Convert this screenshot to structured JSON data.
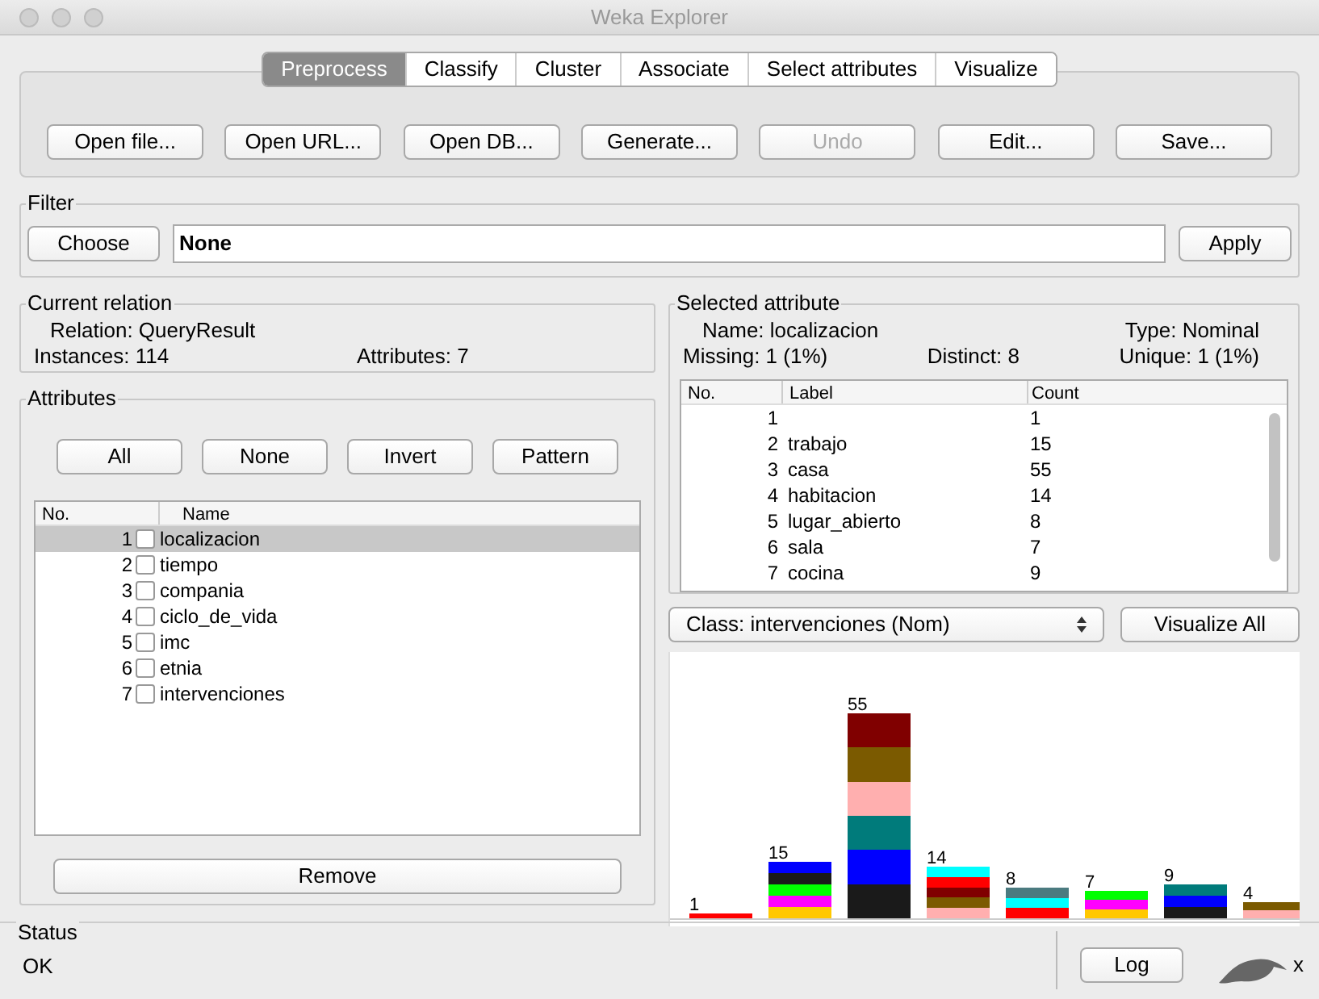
{
  "window": {
    "title": "Weka Explorer"
  },
  "tabs": [
    {
      "label": "Preprocess",
      "selected": true
    },
    {
      "label": "Classify",
      "selected": false
    },
    {
      "label": "Cluster",
      "selected": false
    },
    {
      "label": "Associate",
      "selected": false
    },
    {
      "label": "Select attributes",
      "selected": false
    },
    {
      "label": "Visualize",
      "selected": false
    }
  ],
  "toolbar": [
    {
      "label": "Open file...",
      "disabled": false
    },
    {
      "label": "Open URL...",
      "disabled": false
    },
    {
      "label": "Open DB...",
      "disabled": false
    },
    {
      "label": "Generate...",
      "disabled": false
    },
    {
      "label": "Undo",
      "disabled": true
    },
    {
      "label": "Edit...",
      "disabled": false
    },
    {
      "label": "Save...",
      "disabled": false
    }
  ],
  "filter": {
    "title": "Filter",
    "choose": "Choose",
    "value": "None",
    "apply": "Apply"
  },
  "current_relation": {
    "title": "Current relation",
    "relation": "Relation: QueryResult",
    "instances": "Instances: 114",
    "attributes": "Attributes: 7"
  },
  "attributes": {
    "title": "Attributes",
    "buttons": [
      "All",
      "None",
      "Invert",
      "Pattern"
    ],
    "columns": [
      "No.",
      "Name"
    ],
    "rows": [
      {
        "no": "1",
        "name": "localizacion",
        "checked": false,
        "selected": true
      },
      {
        "no": "2",
        "name": "tiempo",
        "checked": false,
        "selected": false
      },
      {
        "no": "3",
        "name": "compania",
        "checked": false,
        "selected": false
      },
      {
        "no": "4",
        "name": "ciclo_de_vida",
        "checked": false,
        "selected": false
      },
      {
        "no": "5",
        "name": "imc",
        "checked": false,
        "selected": false
      },
      {
        "no": "6",
        "name": "etnia",
        "checked": false,
        "selected": false
      },
      {
        "no": "7",
        "name": "intervenciones",
        "checked": false,
        "selected": false
      }
    ],
    "remove": "Remove"
  },
  "selected_attribute": {
    "title": "Selected attribute",
    "name": "Name: localizacion",
    "type": "Type: Nominal",
    "missing": "Missing: 1 (1%)",
    "distinct": "Distinct: 8",
    "unique": "Unique: 1 (1%)",
    "columns": [
      "No.",
      "Label",
      "Count"
    ],
    "rows": [
      {
        "no": "1",
        "count": "1"
      },
      {
        "no": "2",
        "label": "trabajo",
        "count": "15"
      },
      {
        "no": "3",
        "label": "casa",
        "count": "55"
      },
      {
        "no": "4",
        "label": "habitacion",
        "count": "14"
      },
      {
        "no": "5",
        "label": "lugar_abierto",
        "count": "8"
      },
      {
        "no": "6",
        "label": "sala",
        "count": "7"
      },
      {
        "no": "7",
        "label": "cocina",
        "count": "9"
      }
    ]
  },
  "class_select": {
    "value": "Class: intervenciones (Nom)",
    "visualize_all": "Visualize All"
  },
  "histogram": {
    "bars": [
      {
        "label": "1"
      },
      {
        "label": "15"
      },
      {
        "label": "55"
      },
      {
        "label": "14"
      },
      {
        "label": "8"
      },
      {
        "label": "7"
      },
      {
        "label": "9"
      },
      {
        "label": "4"
      }
    ]
  },
  "status": {
    "title": "Status",
    "message": "OK",
    "log": "Log",
    "count": "x"
  }
}
